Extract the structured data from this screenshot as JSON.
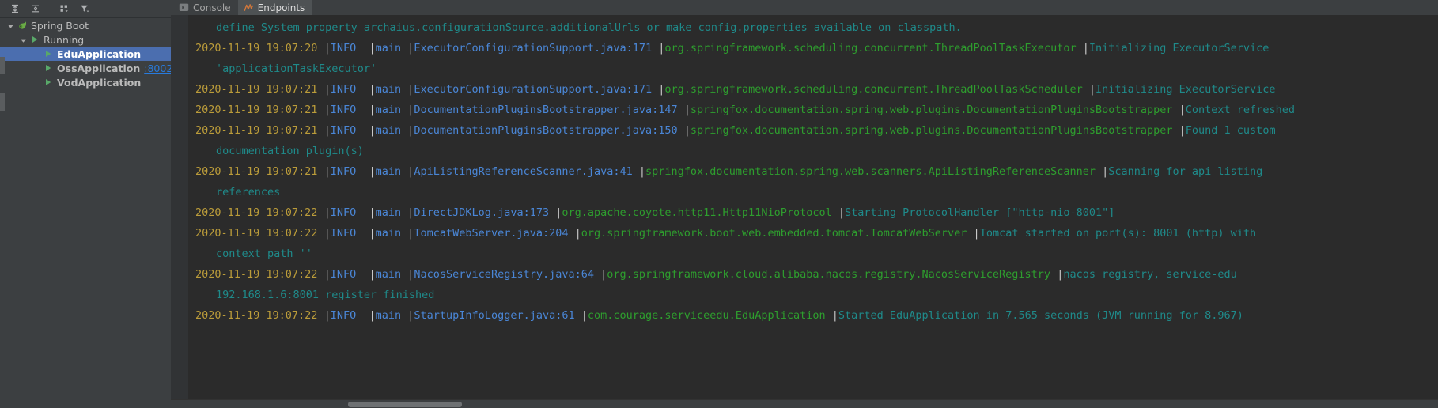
{
  "window": {
    "background": "#3c3f41",
    "console_background": "#2b2b2b"
  },
  "left_panel": {
    "toolbar": {
      "buttons": [
        {
          "name": "expand-all-icon",
          "title": "Expand All"
        },
        {
          "name": "collapse-all-icon",
          "title": "Collapse All"
        },
        {
          "name": "group-by-icon",
          "title": "Group Executions"
        },
        {
          "name": "filter-icon",
          "title": "Filter"
        }
      ]
    },
    "tree": {
      "nodes": [
        {
          "label": "Spring Boot",
          "level": 0,
          "expanded": true,
          "icon": "spring-leaf-icon",
          "selected": false,
          "bold": false,
          "port": "",
          "edit": false
        },
        {
          "label": "Running",
          "level": 1,
          "expanded": true,
          "icon": "run-triangle-icon",
          "selected": false,
          "bold": false,
          "port": "",
          "edit": false
        },
        {
          "label": "EduApplication",
          "level": 2,
          "expanded": false,
          "icon": "run-triangle-icon",
          "selected": true,
          "bold": true,
          "port": "",
          "edit": false
        },
        {
          "label": "OssApplication",
          "level": 2,
          "expanded": false,
          "icon": "run-triangle-icon",
          "selected": false,
          "bold": true,
          "port": ":8002/",
          "edit": true
        },
        {
          "label": "VodApplication",
          "level": 2,
          "expanded": false,
          "icon": "run-triangle-icon",
          "selected": false,
          "bold": true,
          "port": "",
          "edit": false
        }
      ]
    }
  },
  "tabs": [
    {
      "label": "Console",
      "icon": "console-icon",
      "active": false
    },
    {
      "label": "Endpoints",
      "icon": "endpoints-icon",
      "active": true
    }
  ],
  "console": {
    "lines": [
      {
        "type": "continuation",
        "text": "define System property archaius.configurationSource.additionalUrls or make config.properties available on classpath."
      },
      {
        "type": "log",
        "timestamp": "2020-11-19 19:07:20",
        "level": "INFO  ",
        "thread": "main ",
        "source": "ExecutorConfigurationSupport.java:171 ",
        "logger": "org.springframework.scheduling.concurrent.ThreadPoolTaskExecutor ",
        "message": "Initializing ExecutorService"
      },
      {
        "type": "continuation",
        "text": "'applicationTaskExecutor'"
      },
      {
        "type": "log",
        "timestamp": "2020-11-19 19:07:21",
        "level": "INFO  ",
        "thread": "main ",
        "source": "ExecutorConfigurationSupport.java:171 ",
        "logger": "org.springframework.scheduling.concurrent.ThreadPoolTaskScheduler ",
        "message": "Initializing ExecutorService"
      },
      {
        "type": "log",
        "timestamp": "2020-11-19 19:07:21",
        "level": "INFO  ",
        "thread": "main ",
        "source": "DocumentationPluginsBootstrapper.java:147 ",
        "logger": "springfox.documentation.spring.web.plugins.DocumentationPluginsBootstrapper ",
        "message": "Context refreshed"
      },
      {
        "type": "log",
        "timestamp": "2020-11-19 19:07:21",
        "level": "INFO  ",
        "thread": "main ",
        "source": "DocumentationPluginsBootstrapper.java:150 ",
        "logger": "springfox.documentation.spring.web.plugins.DocumentationPluginsBootstrapper ",
        "message": "Found 1 custom"
      },
      {
        "type": "continuation",
        "text": "documentation plugin(s)"
      },
      {
        "type": "log",
        "timestamp": "2020-11-19 19:07:21",
        "level": "INFO  ",
        "thread": "main ",
        "source": "ApiListingReferenceScanner.java:41 ",
        "logger": "springfox.documentation.spring.web.scanners.ApiListingReferenceScanner ",
        "message": "Scanning for api listing"
      },
      {
        "type": "continuation",
        "text": "references"
      },
      {
        "type": "log",
        "timestamp": "2020-11-19 19:07:22",
        "level": "INFO  ",
        "thread": "main ",
        "source": "DirectJDKLog.java:173 ",
        "logger": "org.apache.coyote.http11.Http11NioProtocol ",
        "message": "Starting ProtocolHandler [\"http-nio-8001\"]"
      },
      {
        "type": "log",
        "timestamp": "2020-11-19 19:07:22",
        "level": "INFO  ",
        "thread": "main ",
        "source": "TomcatWebServer.java:204 ",
        "logger": "org.springframework.boot.web.embedded.tomcat.TomcatWebServer ",
        "message": "Tomcat started on port(s): 8001 (http) with"
      },
      {
        "type": "continuation",
        "text": "context path ''"
      },
      {
        "type": "log",
        "timestamp": "2020-11-19 19:07:22",
        "level": "INFO  ",
        "thread": "main ",
        "source": "NacosServiceRegistry.java:64 ",
        "logger": "org.springframework.cloud.alibaba.nacos.registry.NacosServiceRegistry ",
        "message": "nacos registry, service-edu"
      },
      {
        "type": "continuation",
        "text": "192.168.1.6:8001 register finished"
      },
      {
        "type": "log",
        "timestamp": "2020-11-19 19:07:22",
        "level": "INFO  ",
        "thread": "main ",
        "source": "StartupInfoLogger.java:61 ",
        "logger": "com.courage.serviceedu.EduApplication ",
        "message": "Started EduApplication in 7.565 seconds (JVM running for 8.967)"
      }
    ],
    "colors": {
      "timestamp": "#bb9c3a",
      "level": "#4a86d6",
      "thread": "#4a86d6",
      "source": "#4a86d6",
      "logger": "#2e9e2e",
      "message": "#1f8a8a",
      "separator": "#c9c9c9"
    }
  },
  "scrollbar": {
    "horizontal_thumb_left_pct": 14,
    "horizontal_thumb_width_pct": 9
  }
}
